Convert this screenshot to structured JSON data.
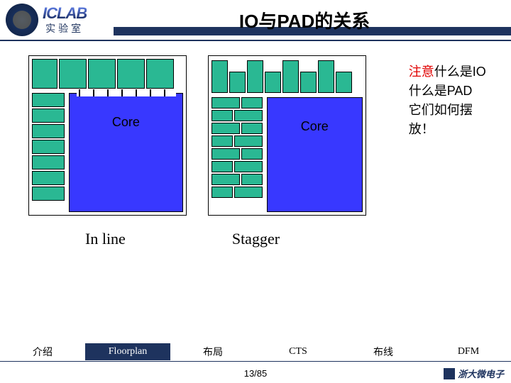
{
  "header": {
    "iclab": "ICLAB",
    "iclab_sub": "实验室",
    "title": "IO与PAD的关系"
  },
  "diagrams": {
    "inline": {
      "core_label": "Core",
      "caption": "In line"
    },
    "stagger": {
      "core_label": "Core",
      "caption": "Stagger"
    }
  },
  "note": {
    "line1a": "注意",
    "line1b": "什么是IO",
    "line2": "什么是PAD",
    "line3": "它们如何摆放！"
  },
  "nav": {
    "items": [
      "介绍",
      "Floorplan",
      "布局",
      "CTS",
      "布线",
      "DFM"
    ],
    "highlighted_index": 1
  },
  "footer": {
    "page": "13/85",
    "brand": "浙大微电子"
  }
}
